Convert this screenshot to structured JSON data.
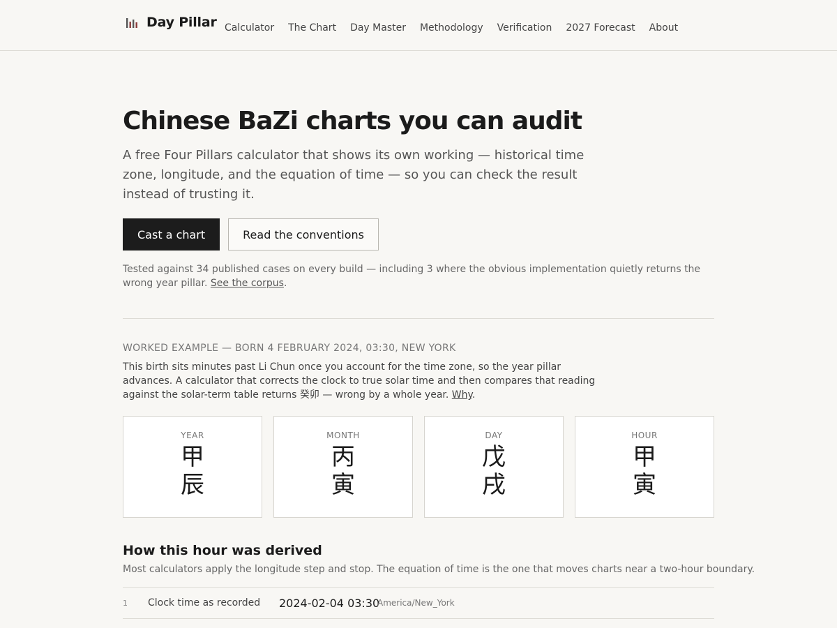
{
  "site": {
    "name": "Day Pillar",
    "logo_icon": "bar-chart-icon",
    "logo_colors": [
      "#555555",
      "#8a3b3b",
      "#555555",
      "#8a3b3b"
    ]
  },
  "nav": {
    "items": [
      "Calculator",
      "The Chart",
      "Day Master",
      "Methodology",
      "Verification",
      "2027 Forecast",
      "About"
    ]
  },
  "hero": {
    "title": "Chinese BaZi charts you can audit",
    "lede": "A free Four Pillars calculator that shows its own working — historical time zone, longitude, and the equation of time — so you can check the result instead of trusting it.",
    "cta_primary": "Cast a chart",
    "cta_secondary": "Read the conventions",
    "note_text": "Tested against 34 published cases on every build — including 3 where the obvious implementation quietly returns the wrong year pillar. ",
    "note_link": "See the corpus",
    "note_end": "."
  },
  "example": {
    "eyebrow": "WORKED EXAMPLE — BORN 4 FEBRUARY 2024, 03:30, NEW YORK",
    "desc_text": "This birth sits minutes past Li Chun once you account for the time zone, so the year pillar advances. A calculator that corrects the clock to true solar time and then compares that reading against the solar-term table returns 癸卯 — wrong by a whole year. ",
    "desc_link": "Why",
    "desc_end": ".",
    "pillars": [
      {
        "label": "YEAR",
        "stem": "甲",
        "branch": "辰"
      },
      {
        "label": "MONTH",
        "stem": "丙",
        "branch": "寅"
      },
      {
        "label": "DAY",
        "stem": "戊",
        "branch": "戌"
      },
      {
        "label": "HOUR",
        "stem": "甲",
        "branch": "寅"
      }
    ]
  },
  "derivation": {
    "title": "How this hour was derived",
    "desc": "Most calculators apply the longitude step and stop. The equation of time is the one that moves charts near a two-hour boundary.",
    "steps": [
      {
        "num": "1",
        "label": "Clock time as recorded",
        "value": "2024-02-04 03:30",
        "tz": "America/New_York"
      }
    ]
  }
}
